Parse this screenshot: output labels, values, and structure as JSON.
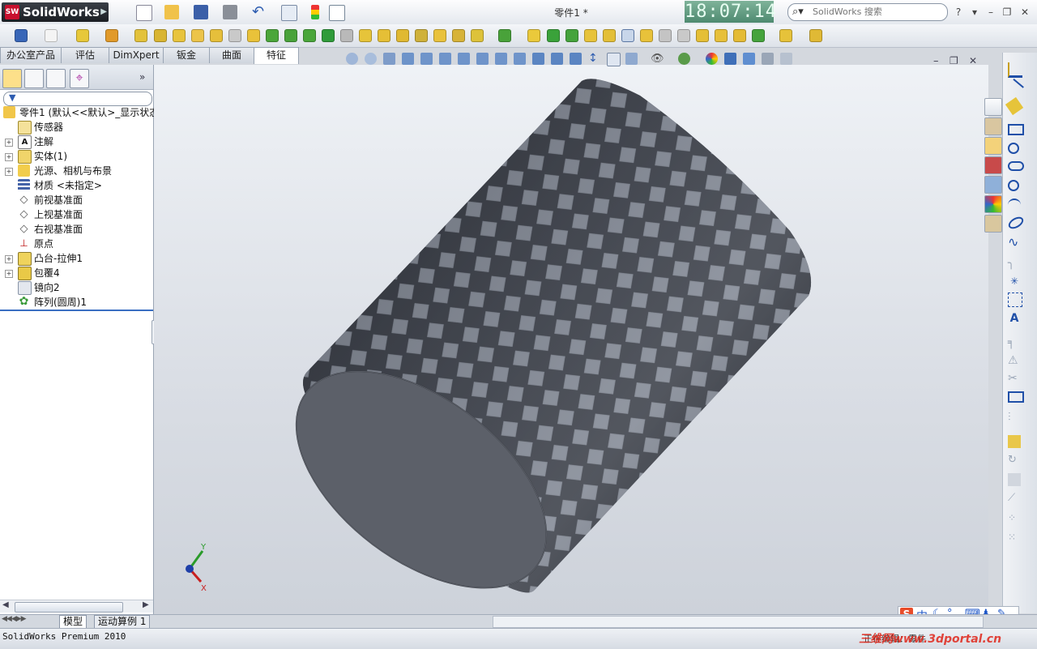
{
  "titlebar": {
    "app_name": "SolidWorks",
    "logo_letters": "SW",
    "document_title": "零件1 *",
    "clock": "18:07:14",
    "search_placeholder": "SolidWorks 搜索",
    "help_label": "?"
  },
  "tabs": [
    {
      "label": "办公室产品",
      "active": false
    },
    {
      "label": "评估",
      "active": false
    },
    {
      "label": "DimXpert",
      "active": false
    },
    {
      "label": "钣金",
      "active": false
    },
    {
      "label": "曲面",
      "active": false
    },
    {
      "label": "特征",
      "active": true
    }
  ],
  "feature_tree": {
    "root": "零件1  (默认<<默认>_显示状态",
    "items": [
      {
        "label": "传感器",
        "expandable": false
      },
      {
        "label": "注解",
        "expandable": true
      },
      {
        "label": "实体(1)",
        "expandable": true
      },
      {
        "label": "光源、相机与布景",
        "expandable": true
      },
      {
        "label": "材质 <未指定>",
        "expandable": false
      },
      {
        "label": "前视基准面",
        "expandable": false
      },
      {
        "label": "上视基准面",
        "expandable": false
      },
      {
        "label": "右视基准面",
        "expandable": false
      },
      {
        "label": "原点",
        "expandable": false
      },
      {
        "label": "凸台-拉伸1",
        "expandable": true
      },
      {
        "label": "包覆4",
        "expandable": true
      },
      {
        "label": "镜向2",
        "expandable": false
      },
      {
        "label": "阵列(圆周)1",
        "expandable": false
      }
    ]
  },
  "triad": {
    "x": "X",
    "y": "Y"
  },
  "bottom_tabs": [
    {
      "label": "模型",
      "active": true
    },
    {
      "label": "运动算例 1",
      "active": false
    }
  ],
  "status": {
    "product": "SolidWorks Premium 2010",
    "units": "正在编辑：零件",
    "watermark": "三维网www.3dportal.cn"
  },
  "ime": {
    "brand": "S",
    "mode": "中"
  },
  "colors": {
    "accent": "#c8102e",
    "clock_bg": "#5e9c80",
    "model": "#5f636d"
  }
}
